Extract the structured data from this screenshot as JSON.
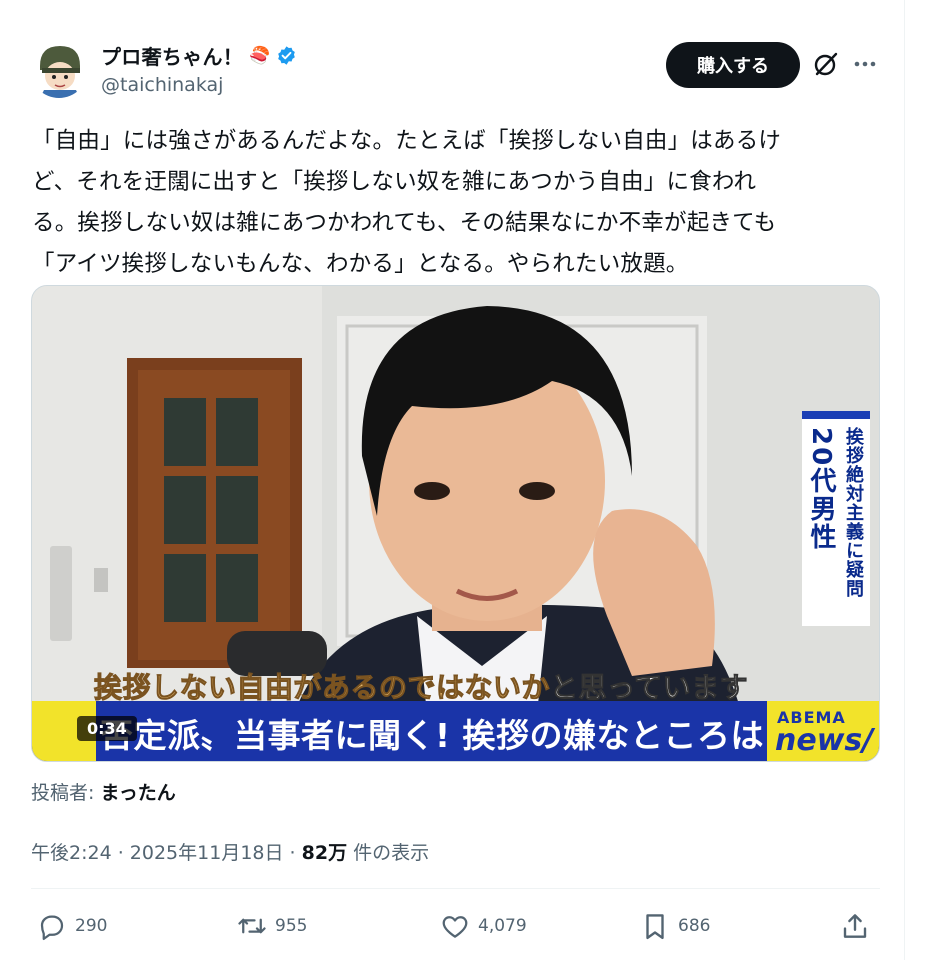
{
  "user": {
    "display_name": "プロ奢ちゃん！",
    "name_emoji": "🍣",
    "handle": "@taichinakaj"
  },
  "header": {
    "buy_label": "購入する"
  },
  "tweet": {
    "lines": [
      "「自由」には強さがあるんだよな。たとえば「挨拶しない自由」はあるけ",
      "ど、それを迂闊に出すと「挨拶しない奴を雑にあつかう自由」に食われ",
      "る。挨拶しない奴は雑にあつかわれても、その結果なにか不幸が起きても",
      "「アイツ挨拶しないもんな、わかる」となる。やられたい放題。"
    ]
  },
  "media": {
    "side_caption_a": "挨拶絶対主義に疑問",
    "side_caption_b": "20代男性",
    "subtitle_highlight": "挨拶しない自由があるのではないか",
    "subtitle_rest": "と思っています",
    "headline": "否定派〟当事者に聞く! 挨拶の嫌なところは",
    "abema_top": "ABEMA",
    "abema_bottom": "news/",
    "duration": "0:34"
  },
  "attribution": {
    "label": "投稿者: ",
    "name": "まったん"
  },
  "meta": {
    "time_date": "午後2:24 · 2025年11月18日 · ",
    "views": "82万",
    "views_suffix": " 件の表示"
  },
  "actions": {
    "replies": "290",
    "retweets": "955",
    "likes": "4,079",
    "bookmarks": "686"
  },
  "colors": {
    "text": "#0f1419",
    "secondary": "#536471",
    "verified": "#1d9bf0",
    "abema_blue": "#1a34a8",
    "abema_yellow": "#f2e32a"
  }
}
